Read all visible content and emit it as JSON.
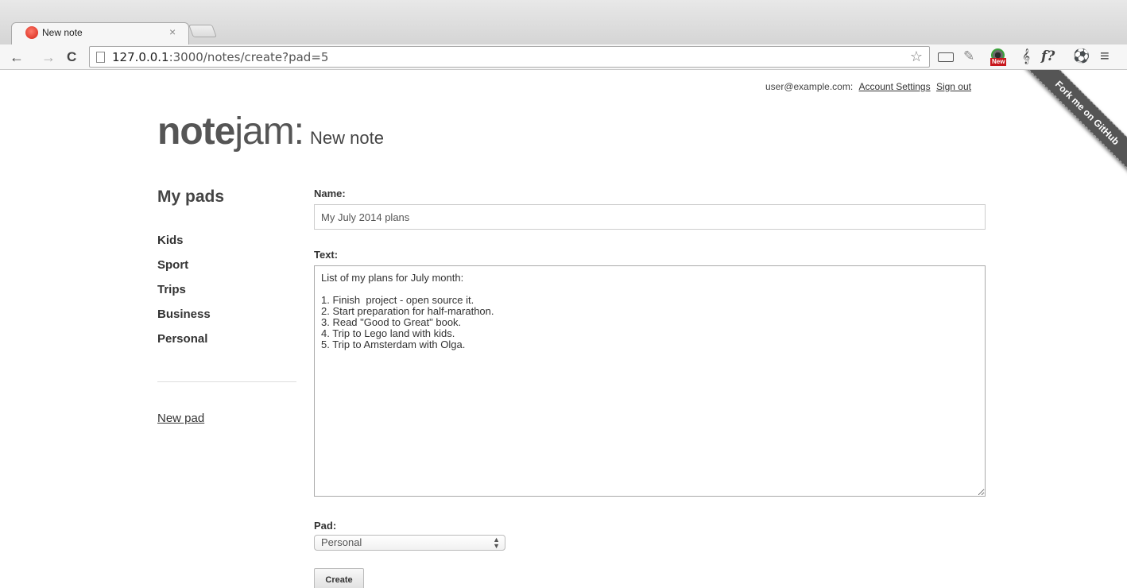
{
  "browser": {
    "tab_title": "New note",
    "tab_close": "×",
    "url_host": "127.0.0.1",
    "url_rest": ":3000/notes/create?pad=5",
    "ext_new_badge": "New",
    "ext_fx": "f?"
  },
  "account": {
    "email": "user@example.com:",
    "settings_label": "Account Settings",
    "signout_label": "Sign out"
  },
  "ribbon": {
    "label": "Fork me on GitHub"
  },
  "brand": {
    "bold": "note",
    "light": "jam:",
    "subtitle": "New note"
  },
  "sidebar": {
    "title": "My pads",
    "pads": [
      "Kids",
      "Sport",
      "Trips",
      "Business",
      "Personal"
    ],
    "new_pad_label": "New pad"
  },
  "form": {
    "name_label": "Name:",
    "name_value": "My July 2014 plans",
    "text_label": "Text:",
    "text_value": "List of my plans for July month:\n\n1. Finish  project - open source it.\n2. Start preparation for half-marathon.\n3. Read \"Good to Great\" book.\n4. Trip to Lego land with kids.\n5. Trip to Amsterdam with Olga.",
    "pad_label": "Pad:",
    "pad_selected": "Personal",
    "create_label": "Create"
  }
}
